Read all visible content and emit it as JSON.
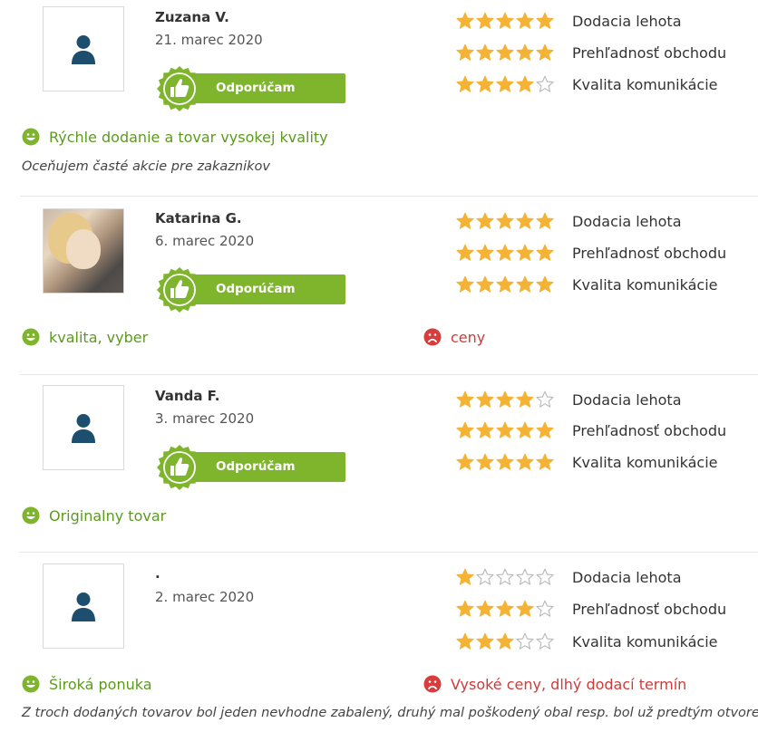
{
  "colors": {
    "accent_green": "#7fb42d",
    "positive_text": "#5c9a1f",
    "negative_text": "#d03a3a",
    "star": "#f5b335"
  },
  "reviews": [
    {
      "name": "Zuzana V.",
      "date": "21. marec 2020",
      "avatar": "user-silhouette-icon",
      "recommend_label": "Odporúčam obchod",
      "ratings": [
        {
          "label": "Dodacia lehota",
          "stars": 5
        },
        {
          "label": "Prehľadnosť obchodu",
          "stars": 5
        },
        {
          "label": "Kvalita komunikácie",
          "stars": 4
        }
      ],
      "positive": "Rýchle dodanie a tovar vysokej kvality",
      "negative": "",
      "comment": "Oceňujem časté akcie pre zakaznikov"
    },
    {
      "name": "Katarina G.",
      "date": "6. marec 2020",
      "avatar": "user-photo",
      "recommend_label": "Odporúčam obchod",
      "ratings": [
        {
          "label": "Dodacia lehota",
          "stars": 5
        },
        {
          "label": "Prehľadnosť obchodu",
          "stars": 5
        },
        {
          "label": "Kvalita komunikácie",
          "stars": 5
        }
      ],
      "positive": "kvalita, vyber",
      "negative": "ceny",
      "comment": ""
    },
    {
      "name": "Vanda F.",
      "date": "3. marec 2020",
      "avatar": "user-silhouette-icon",
      "recommend_label": "Odporúčam obchod",
      "ratings": [
        {
          "label": "Dodacia lehota",
          "stars": 4
        },
        {
          "label": "Prehľadnosť obchodu",
          "stars": 5
        },
        {
          "label": "Kvalita komunikácie",
          "stars": 5
        }
      ],
      "positive": "Originalny tovar",
      "negative": "",
      "comment": ""
    },
    {
      "name": ".",
      "date": "2. marec 2020",
      "avatar": "user-silhouette-icon",
      "recommend_label": "",
      "ratings": [
        {
          "label": "Dodacia lehota",
          "stars": 1
        },
        {
          "label": "Prehľadnosť obchodu",
          "stars": 4
        },
        {
          "label": "Kvalita komunikácie",
          "stars": 3
        }
      ],
      "positive": "Široká ponuka",
      "negative": "Vysoké ceny, dlhý dodací termín",
      "comment": "Z troch dodaných tovarov bol jeden nevhodne zabalený, druhý mal poškodený obal resp. bol už predtým otvorený."
    }
  ]
}
